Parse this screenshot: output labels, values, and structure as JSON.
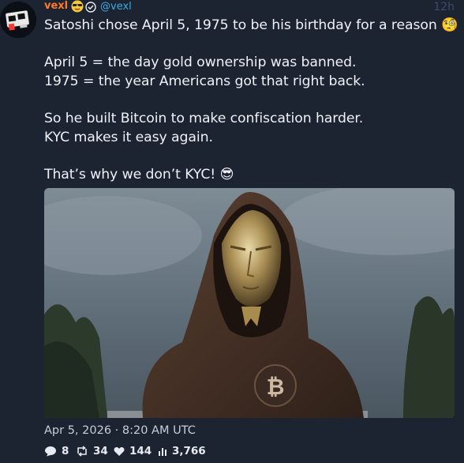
{
  "author": {
    "name": "vexl",
    "handle": "@vexl",
    "name_icon": "sunglasses-emoji-icon",
    "verified_icon": "verified-check-icon"
  },
  "post": {
    "time_ago": "12h",
    "lines": [
      "Satoshi chose April 5, 1975 to be his birthday for a reason 🧐",
      "April 5 = the day gold ownership was banned.",
      "1975 = the year Americans got that right back.",
      "So he built Bitcoin to make confiscation harder.",
      "KYC makes it easy again.",
      "That’s why we don’t KYC! 😎"
    ],
    "image_icon": "bitcoin-logo-icon",
    "timestamp": "Apr 5, 2026 · 8:20 AM UTC"
  },
  "stats": {
    "replies": "8",
    "reposts": "34",
    "likes": "144",
    "views": "3,766",
    "icons": [
      "reply-bubble-icon",
      "repost-icon",
      "heart-icon",
      "views-bar-chart-icon"
    ]
  },
  "colors": {
    "background": "#1c2331",
    "name": "#ff7a2a",
    "handle": "#3fa9e6",
    "time": "#3c4c6c"
  }
}
